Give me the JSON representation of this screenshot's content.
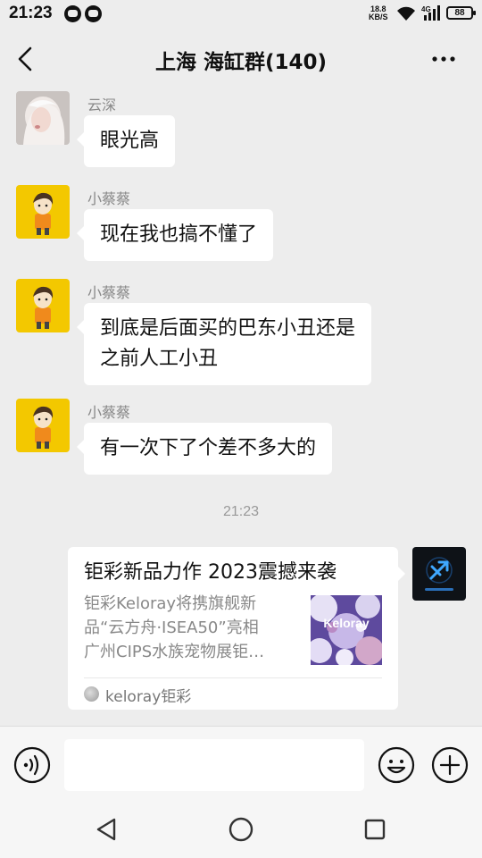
{
  "status_bar": {
    "time": "21:23",
    "net_speed_value": "18.8",
    "net_speed_unit": "KB/S",
    "signal_label": "4G",
    "battery": "88"
  },
  "header": {
    "title": "上海 海缸群(140)"
  },
  "messages": [
    {
      "sender": "云深",
      "text": "眼光高"
    },
    {
      "sender": "小蔡蔡",
      "text": "现在我也搞不懂了"
    },
    {
      "sender": "小蔡蔡",
      "lines": [
        "到底是后面买的巴东小丑还是",
        "之前人工小丑"
      ]
    },
    {
      "sender": "小蔡蔡",
      "text": "有一次下了个差不多大的"
    }
  ],
  "timestamp": "21:23",
  "shared_card": {
    "title": "钜彩新品力作 2023震撼来袭",
    "desc_lines": [
      "钜彩Keloray将携旗舰新",
      "品“云方舟·ISEA50”亮相",
      "广州CIPS水族宠物展钜…"
    ],
    "thumb_text": "Keloray",
    "source": "keloray钜彩"
  },
  "input": {
    "placeholder": ""
  }
}
